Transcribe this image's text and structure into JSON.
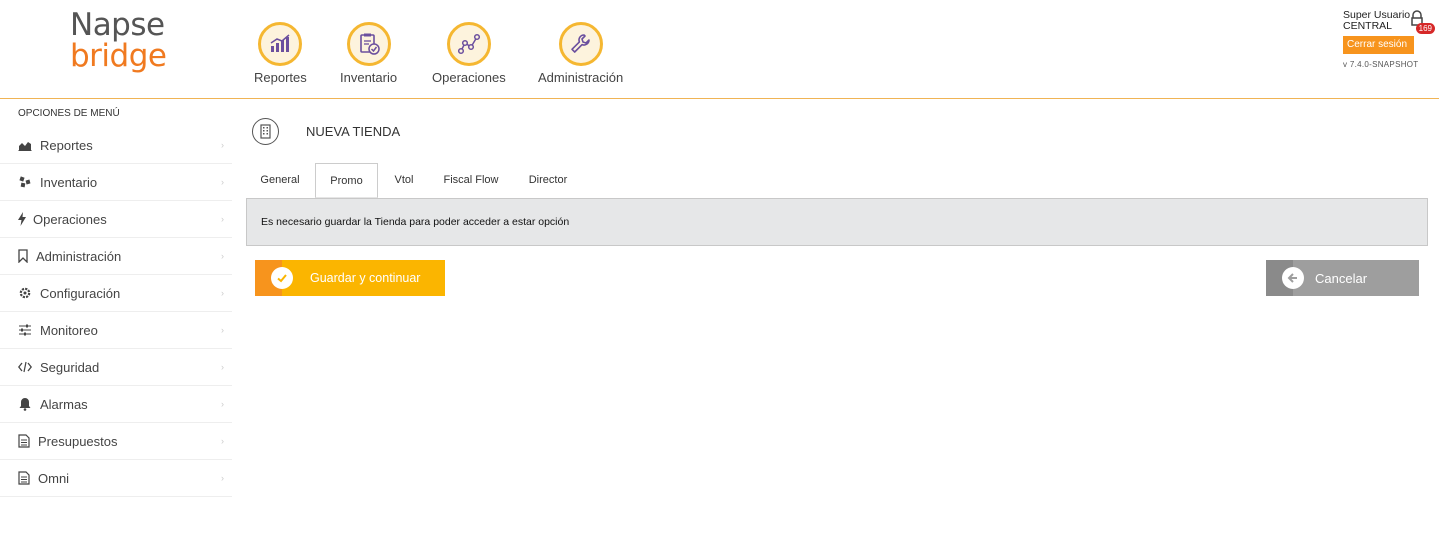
{
  "logo": {
    "line1": "Napse",
    "line2": "bridge"
  },
  "topnav": [
    {
      "label": "Reportes",
      "icon": "chart-icon"
    },
    {
      "label": "Inventario",
      "icon": "clipboard-check-icon"
    },
    {
      "label": "Operaciones",
      "icon": "nodes-icon"
    },
    {
      "label": "Administración",
      "icon": "wrench-icon"
    }
  ],
  "user": {
    "name": "Super Usuario",
    "store": "CENTRAL",
    "notifications": "169",
    "logout": "Cerrar sesión",
    "version": "v 7.4.0-SNAPSHOT"
  },
  "sidebar": {
    "title": "OPCIONES DE MENÚ",
    "items": [
      {
        "label": "Reportes",
        "icon": "area-chart-icon"
      },
      {
        "label": "Inventario",
        "icon": "boxes-icon"
      },
      {
        "label": "Operaciones",
        "icon": "bolt-icon"
      },
      {
        "label": "Administración",
        "icon": "bookmark-icon"
      },
      {
        "label": "Configuración",
        "icon": "gear-icon"
      },
      {
        "label": "Monitoreo",
        "icon": "sliders-icon"
      },
      {
        "label": "Seguridad",
        "icon": "code-icon"
      },
      {
        "label": "Alarmas",
        "icon": "bell-icon"
      },
      {
        "label": "Presupuestos",
        "icon": "document-icon"
      },
      {
        "label": "Omni",
        "icon": "document-icon"
      }
    ]
  },
  "page": {
    "title": "NUEVA TIENDA",
    "tabs": [
      "General",
      "Promo",
      "Vtol",
      "Fiscal Flow",
      "Director"
    ],
    "active_tab": "Promo",
    "alert": "Es necesario guardar la Tienda para poder acceder a estar opción",
    "save_label": "Guardar y continuar",
    "cancel_label": "Cancelar"
  },
  "colors": {
    "accent": "#f7941d",
    "save": "#fbb500",
    "cancel": "#9e9e9e",
    "badge": "#d62828"
  }
}
